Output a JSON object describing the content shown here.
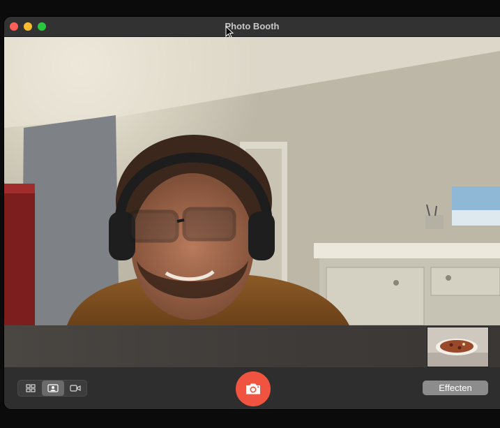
{
  "window": {
    "title": "Photo Booth"
  },
  "toolbar": {
    "layout_modes": [
      {
        "icon": "grid-icon",
        "active": false
      },
      {
        "icon": "portrait-icon",
        "active": true
      },
      {
        "icon": "video-camera-icon",
        "active": false
      }
    ],
    "effects_label": "Effecten"
  },
  "colors": {
    "shutter": "#f0533f",
    "traffic_close": "#ff5f57",
    "traffic_minimize": "#febc2e",
    "traffic_zoom": "#28c840"
  }
}
